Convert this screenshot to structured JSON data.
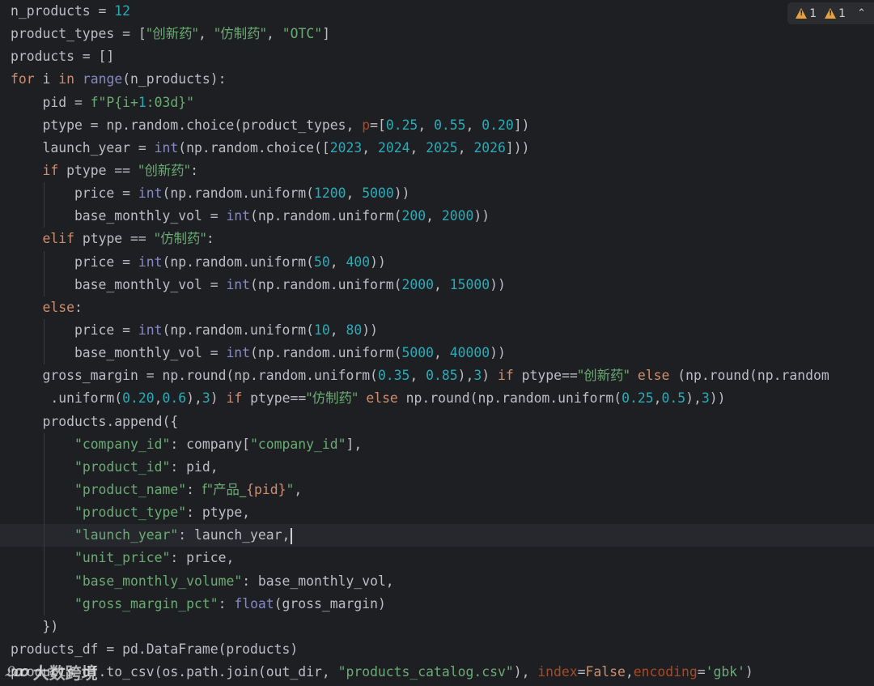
{
  "inspections": {
    "warning_count": "1",
    "weak_warning_count": "1"
  },
  "watermark": {
    "logo": "𝔏ꝏ",
    "text": "大数跨境"
  },
  "code": {
    "l1": [
      "n_products = ",
      "12"
    ],
    "l2": [
      "product_types = [",
      "\"创新药\"",
      ", ",
      "\"仿制药\"",
      ", ",
      "\"OTC\"",
      "]"
    ],
    "l3": [
      "products = []"
    ],
    "l4": [
      "for",
      " i ",
      "in",
      " ",
      "range",
      "(n_products):"
    ],
    "l5": [
      "    pid = ",
      "f\"P{i+",
      "1",
      ":03d}\""
    ],
    "l6": [
      "    ptype = np.random.choice(product_types, ",
      "p",
      "=[",
      "0.25",
      ", ",
      "0.55",
      ", ",
      "0.20",
      "])"
    ],
    "l7": [
      "    launch_year = ",
      "int",
      "(np.random.choice([",
      "2023",
      ", ",
      "2024",
      ", ",
      "2025",
      ", ",
      "2026",
      "]))"
    ],
    "l8": [
      "    ",
      "if",
      " ptype == ",
      "\"创新药\"",
      ":"
    ],
    "l9": [
      "        price = ",
      "int",
      "(np.random.uniform(",
      "1200",
      ", ",
      "5000",
      "))"
    ],
    "l10": [
      "        base_monthly_vol = ",
      "int",
      "(np.random.uniform(",
      "200",
      ", ",
      "2000",
      "))"
    ],
    "l11": [
      "    ",
      "elif",
      " ptype == ",
      "\"仿制药\"",
      ":"
    ],
    "l12": [
      "        price = ",
      "int",
      "(np.random.uniform(",
      "50",
      ", ",
      "400",
      "))"
    ],
    "l13": [
      "        base_monthly_vol = ",
      "int",
      "(np.random.uniform(",
      "2000",
      ", ",
      "15000",
      "))"
    ],
    "l14": [
      "    ",
      "else",
      ":"
    ],
    "l15": [
      "        price = ",
      "int",
      "(np.random.uniform(",
      "10",
      ", ",
      "80",
      "))"
    ],
    "l16": [
      "        base_monthly_vol = ",
      "int",
      "(np.random.uniform(",
      "5000",
      ", ",
      "40000",
      "))"
    ],
    "l17": [
      "    gross_margin = np.round(np.random.uniform(",
      "0.35",
      ", ",
      "0.85",
      "),",
      "3",
      ") ",
      "if",
      " ptype==",
      "\"创新药\"",
      " ",
      "else",
      " (np.round(np.random"
    ],
    "l18": [
      "     .uniform(",
      "0.20",
      ",",
      "0.6",
      "),",
      "3",
      ") ",
      "if",
      " ptype==",
      "\"仿制药\"",
      " ",
      "else",
      " np.round(np.random.uniform(",
      "0.25",
      ",",
      "0.5",
      "),",
      "3",
      "))"
    ],
    "l19": [
      "    products.append({"
    ],
    "l20": [
      "        ",
      "\"company_id\"",
      ": company[",
      "\"company_id\"",
      "],"
    ],
    "l21": [
      "        ",
      "\"product_id\"",
      ": pid,"
    ],
    "l22": [
      "        ",
      "\"product_name\"",
      ": ",
      "f\"产品_",
      "{pid}",
      "\"",
      ","
    ],
    "l23": [
      "        ",
      "\"product_type\"",
      ": ptype,"
    ],
    "l24": [
      "        ",
      "\"launch_year\"",
      ": launch_year,"
    ],
    "l25": [
      "        ",
      "\"unit_price\"",
      ": price,"
    ],
    "l26": [
      "        ",
      "\"base_monthly_volume\"",
      ": base_monthly_vol,"
    ],
    "l27": [
      "        ",
      "\"gross_margin_pct\"",
      ": ",
      "float",
      "(gross_margin)"
    ],
    "l28": [
      "    })"
    ],
    "l29": [
      "products_df = pd.DataFrame(products)"
    ],
    "l30": [
      "products_df.to_csv(os.path.join(out_dir, ",
      "\"products_catalog.csv\"",
      "), ",
      "index",
      "=",
      "False",
      ",",
      "encoding",
      "=",
      "'gbk'",
      ")"
    ]
  },
  "colors": {
    "background": "#1e1f22",
    "keyword": "#cf8e6d",
    "builtin": "#8888c6",
    "number": "#2aacb8",
    "string": "#6aab73",
    "named_param": "#aa4926",
    "warning": "#e6a03c"
  }
}
